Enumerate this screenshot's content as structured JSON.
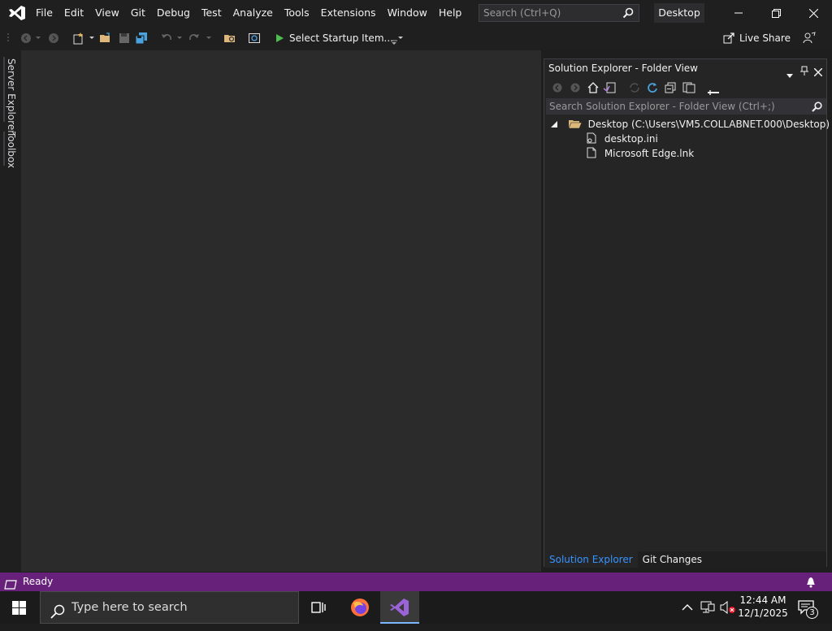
{
  "app": {
    "menu": [
      "File",
      "Edit",
      "View",
      "Git",
      "Debug",
      "Test",
      "Analyze",
      "Tools",
      "Extensions",
      "Window",
      "Help"
    ],
    "search_placeholder": "Search (Ctrl+Q)",
    "window_label": "Desktop",
    "accent_color": "#68217a"
  },
  "toolbar": {
    "startup_label": "Select Startup Item...",
    "live_share_label": "Live Share"
  },
  "side_tabs": [
    "Server Explorer",
    "Toolbox"
  ],
  "solution_explorer": {
    "title": "Solution Explorer - Folder View",
    "search_placeholder": "Search Solution Explorer - Folder View (Ctrl+;)",
    "root": "Desktop (C:\\Users\\VM5.COLLABNET.000\\Desktop)",
    "files": [
      "desktop.ini",
      "Microsoft Edge.lnk"
    ],
    "bottom_tabs": [
      "Solution Explorer",
      "Git Changes"
    ]
  },
  "status": {
    "text": "Ready"
  },
  "taskbar": {
    "search_placeholder": "Type here to search",
    "time": "12:44 AM",
    "date": "12/1/2025",
    "notification_count": "3"
  }
}
